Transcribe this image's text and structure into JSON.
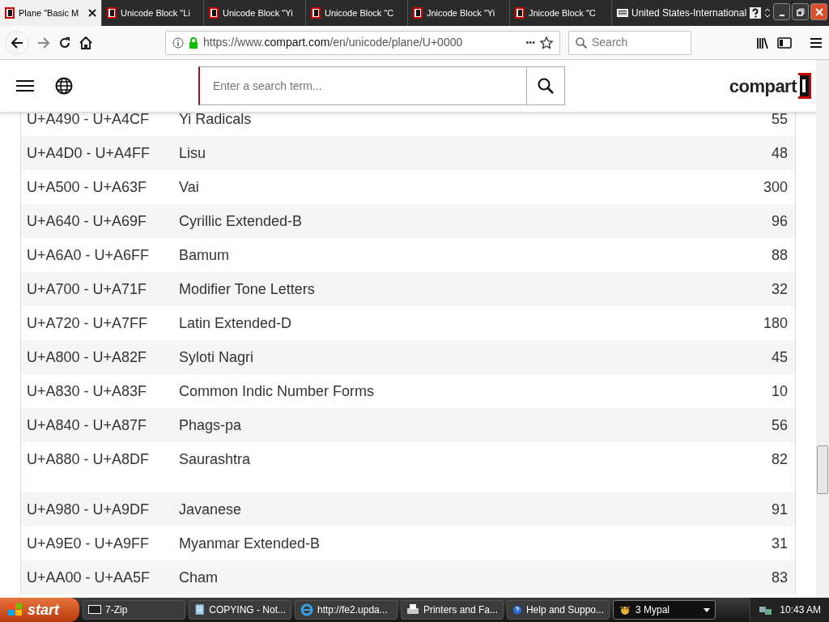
{
  "browser_tabs": [
    {
      "title": "Plane \"Basic M",
      "selected": true
    },
    {
      "title": "Unicode Block \"Li",
      "selected": false
    },
    {
      "title": "Unicode Block \"Yi",
      "selected": false
    },
    {
      "title": "Unicode Block \"C",
      "selected": false
    },
    {
      "title": "Jnicode Block \"Yi",
      "selected": false
    },
    {
      "title": "Jnicode Block \"C",
      "selected": false
    }
  ],
  "language_bar": {
    "label": "United States-International"
  },
  "address_bar": {
    "url_prefix": "https://www.",
    "url_domain": "compart.com",
    "url_path": "/en/unicode/plane/U+0000",
    "more": "•••"
  },
  "browser_search": {
    "placeholder": "Search"
  },
  "site_header": {
    "search_placeholder": "Enter a search term...",
    "logo": "compart"
  },
  "blocks": [
    {
      "range": "U+A490 - U+A4CF",
      "name": "Yi Radicals",
      "count": "55"
    },
    {
      "range": "U+A4D0 - U+A4FF",
      "name": "Lisu",
      "count": "48"
    },
    {
      "range": "U+A500 - U+A63F",
      "name": "Vai",
      "count": "300"
    },
    {
      "range": "U+A640 - U+A69F",
      "name": "Cyrillic Extended-B",
      "count": "96"
    },
    {
      "range": "U+A6A0 - U+A6FF",
      "name": "Bamum",
      "count": "88"
    },
    {
      "range": "U+A700 - U+A71F",
      "name": "Modifier Tone Letters",
      "count": "32"
    },
    {
      "range": "U+A720 - U+A7FF",
      "name": "Latin Extended-D",
      "count": "180"
    },
    {
      "range": "U+A800 - U+A82F",
      "name": "Syloti Nagri",
      "count": "45"
    },
    {
      "range": "U+A830 - U+A83F",
      "name": "Common Indic Number Forms",
      "count": "10"
    },
    {
      "range": "U+A840 - U+A87F",
      "name": "Phags-pa",
      "count": "56"
    },
    {
      "range": "U+A880 - U+A8DF",
      "name": "Saurashtra",
      "count": "82"
    },
    {
      "range": "U+A980 - U+A9DF",
      "name": "Javanese",
      "count": "91"
    },
    {
      "range": "U+A9E0 - U+A9FF",
      "name": "Myanmar Extended-B",
      "count": "31"
    },
    {
      "range": "U+AA00 - U+AA5F",
      "name": "Cham",
      "count": "83"
    }
  ],
  "taskbar": {
    "start": "start",
    "items": [
      {
        "label": "7-Zip",
        "kind": "archive",
        "selected": false
      },
      {
        "label": "COPYING - Not...",
        "kind": "notepad",
        "selected": false
      },
      {
        "label": "http://fe2.upda...",
        "kind": "web",
        "selected": false
      },
      {
        "label": "Printers and Fa...",
        "kind": "printers",
        "selected": false
      },
      {
        "label": "Help and Suppo...",
        "kind": "help",
        "selected": false
      },
      {
        "label": "3 Mypal",
        "kind": "group",
        "selected": true
      }
    ],
    "clock": "10:43 AM"
  }
}
